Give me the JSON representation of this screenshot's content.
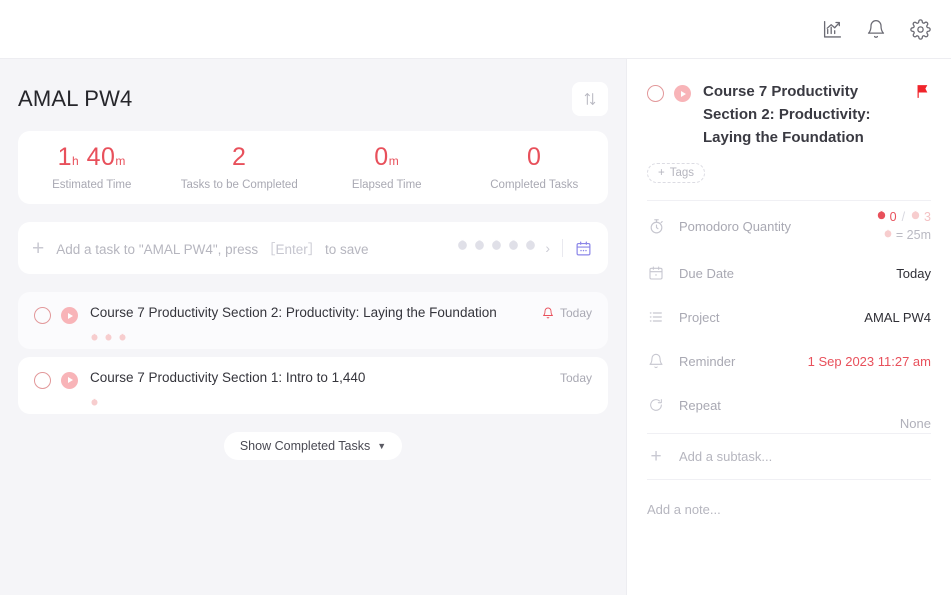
{
  "topbar": {
    "icons": [
      {
        "name": "statistics-icon",
        "label": "Statistics"
      },
      {
        "name": "notification-bell-icon",
        "label": "Notifications"
      },
      {
        "name": "settings-gear-icon",
        "label": "Settings"
      }
    ]
  },
  "list": {
    "project_title": "AMAL PW4",
    "sort_icon": "sort-updown-icon",
    "stats": [
      {
        "value": "1",
        "unit1": "h",
        "value2": "40",
        "unit2": "m",
        "label": "Estimated Time"
      },
      {
        "value": "2",
        "unit1": "",
        "value2": "",
        "unit2": "",
        "label": "Tasks to be Completed"
      },
      {
        "value": "0",
        "unit1": "m",
        "value2": "",
        "unit2": "",
        "label": "Elapsed Time"
      },
      {
        "value": "0",
        "unit1": "",
        "value2": "",
        "unit2": "",
        "label": "Completed Tasks"
      }
    ],
    "add_task": {
      "placeholder_part1": "Add a task to \"AMAL PW4\", press",
      "enter_key": "［Enter］",
      "placeholder_part2": "to save",
      "pomodoro_slots": 5,
      "chevron": "›",
      "calendar_icon": "calendar-icon"
    },
    "tasks": [
      {
        "title": "Course 7 Productivity Section 2: Productivity: Laying the Foundation",
        "pomodoro_dots": 3,
        "has_reminder": true,
        "due": "Today",
        "selected": true
      },
      {
        "title": "Course 7 Productivity Section 1: Intro to 1,440",
        "pomodoro_dots": 1,
        "has_reminder": false,
        "due": "Today",
        "selected": false
      }
    ],
    "show_completed_label": "Show Completed Tasks",
    "show_completed_caret": "▼"
  },
  "detail": {
    "title": "Course 7 Productivity Section 2: Productivity: Laying the Foundation",
    "flag_icon": "flag-icon",
    "tags_label": "Tags",
    "tags_plus": "+",
    "properties": [
      {
        "icon": "stopwatch-icon",
        "label": "Pomodoro Quantity",
        "type": "pomodoro",
        "completed": "0",
        "slash": "/",
        "total": "3",
        "duration": "= 25m"
      },
      {
        "icon": "calendar-icon",
        "label": "Due Date",
        "type": "text",
        "value": "Today",
        "style": "normal"
      },
      {
        "icon": "list-icon",
        "label": "Project",
        "type": "text",
        "value": "AMAL PW4",
        "style": "normal"
      },
      {
        "icon": "bell-icon",
        "label": "Reminder",
        "type": "text",
        "value": "1 Sep 2023 11:27 am",
        "style": "accent"
      },
      {
        "icon": "repeat-icon",
        "label": "Repeat",
        "type": "text",
        "value": "None",
        "style": "muted"
      }
    ],
    "add_subtask_placeholder": "Add a subtask...",
    "add_subtask_plus": "+",
    "add_note_placeholder": "Add a note..."
  },
  "colors": {
    "accent_red": "#e8505b",
    "flag_red": "#f0242b",
    "calendar_purple": "#8b86e8",
    "pane_bg": "#f5f5f8",
    "card_bg": "#ffffff"
  }
}
